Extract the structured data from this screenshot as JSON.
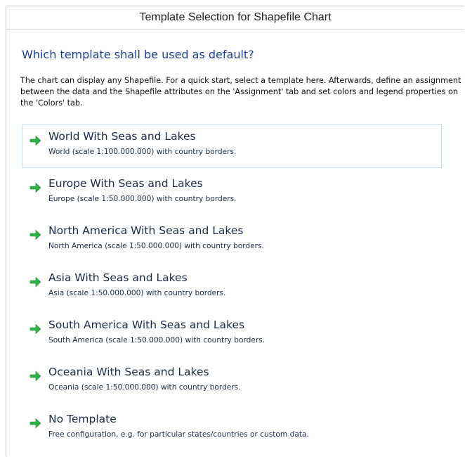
{
  "window": {
    "title": "Template Selection for Shapefile Chart"
  },
  "main": {
    "heading": "Which template shall be used as default?",
    "description": "The chart can display any Shapefile. For a quick start, select a template here. Afterwards, define an assignment between the data and the Shapefile attributes on the 'Assignment' tab and set colors and legend properties on the 'Colors' tab.",
    "options": [
      {
        "title": "World With Seas and Lakes",
        "description": "World (scale 1:100.000.000) with country borders.",
        "icon": "green-arrow-right-icon",
        "selected": true
      },
      {
        "title": "Europe With Seas and Lakes",
        "description": "Europe (scale 1:50.000.000) with country borders.",
        "icon": "green-arrow-right-icon",
        "selected": false
      },
      {
        "title": "North America With Seas and Lakes",
        "description": "North America (scale 1:50.000.000) with country borders.",
        "icon": "green-arrow-right-icon",
        "selected": false
      },
      {
        "title": "Asia With Seas and Lakes",
        "description": "Asia (scale 1:50.000.000) with country borders.",
        "icon": "green-arrow-right-icon",
        "selected": false
      },
      {
        "title": "South America With Seas and Lakes",
        "description": "South America (scale 1:50.000.000) with country borders.",
        "icon": "green-arrow-right-icon",
        "selected": false
      },
      {
        "title": "Oceania With Seas and Lakes",
        "description": "Oceania (scale 1:50.000.000) with country borders.",
        "icon": "green-arrow-right-icon",
        "selected": false
      },
      {
        "title": "No Template",
        "description": "Free configuration, e.g. for particular states/countries or custom data.",
        "icon": "green-arrow-right-icon",
        "selected": false
      }
    ]
  },
  "colors": {
    "heading": "#1a3f9e",
    "arrow": "#2fb34a",
    "selected_border": "#bfe6f2"
  }
}
